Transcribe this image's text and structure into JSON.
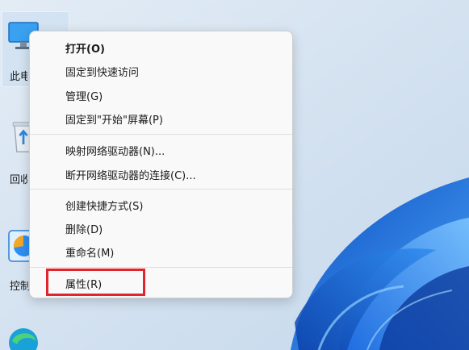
{
  "desktop": {
    "icons": [
      {
        "name": "this-pc",
        "label": "此电脑",
        "icon": "monitor-icon"
      },
      {
        "name": "recycle-bin",
        "label": "回收站",
        "icon": "recycle-bin-icon"
      },
      {
        "name": "control-panel",
        "label": "控制面板",
        "icon": "control-panel-icon"
      },
      {
        "name": "edge",
        "label": "",
        "icon": "edge-icon"
      }
    ]
  },
  "context_menu": {
    "items": [
      {
        "label": "打开(O)"
      },
      {
        "label": "固定到快速访问"
      },
      {
        "label": "管理(G)"
      },
      {
        "label": "固定到\"开始\"屏幕(P)"
      },
      {
        "label": "映射网络驱动器(N)..."
      },
      {
        "label": "断开网络驱动器的连接(C)..."
      },
      {
        "label": "创建快捷方式(S)"
      },
      {
        "label": "删除(D)"
      },
      {
        "label": "重命名(M)"
      },
      {
        "label": "属性(R)"
      }
    ]
  },
  "colors": {
    "highlight_border": "#e0262c",
    "menu_background": "#f9f9f9",
    "wallpaper_accent": "#1a73e8"
  }
}
